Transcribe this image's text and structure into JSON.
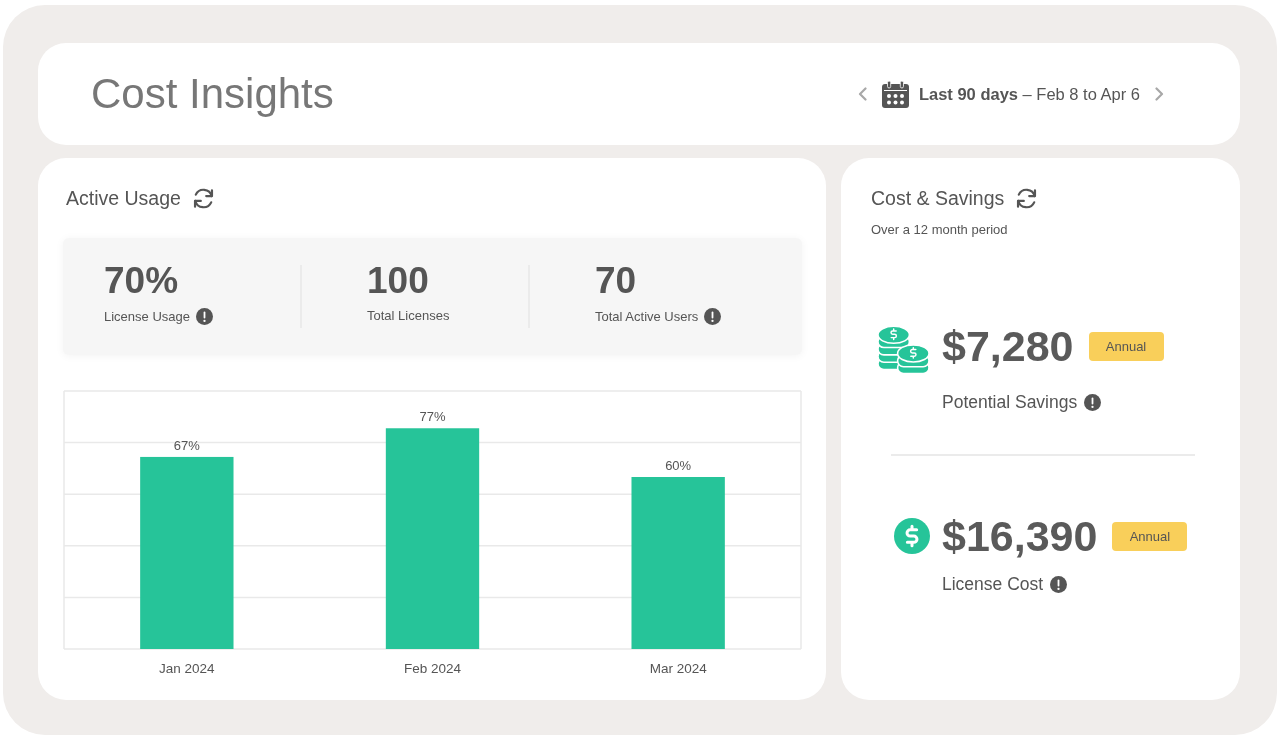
{
  "header": {
    "title": "Cost Insights",
    "date_range": "**Last 90 days** – Feb 8 to Apr 6"
  },
  "active_usage": {
    "title": "Active Usage",
    "stats": [
      {
        "value": "70%",
        "label": "License Usage",
        "info_icon": true
      },
      {
        "value": "100",
        "label": "Total Licenses",
        "info_icon": false
      },
      {
        "value": "70",
        "label": "Total Active Users",
        "info_icon": true
      }
    ],
    "chart_data": {
      "type": "bar",
      "categories": [
        "Jan 2024",
        "Feb 2024",
        "Mar 2024"
      ],
      "values": [
        67,
        77,
        60
      ],
      "ylim": [
        0,
        90
      ],
      "value_labels": [
        "67%",
        "77%",
        "60%"
      ]
    }
  },
  "cost_savings": {
    "title": "Cost & Savings",
    "subtitle": "Over a 12 month period",
    "items": [
      {
        "kind": "coins",
        "amount": "$7,280",
        "badge": "Annual",
        "label": "Potential Savings",
        "info_icon": true
      },
      {
        "kind": "dollar",
        "amount": "$16,390",
        "badge": "Annual",
        "label": "License Cost",
        "info_icon": true
      }
    ]
  }
}
